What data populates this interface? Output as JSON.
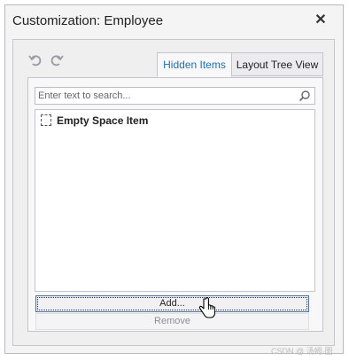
{
  "window": {
    "title": "Customization: Employee",
    "close_icon": "close-icon"
  },
  "toolbar": {
    "undo_icon": "undo-icon",
    "redo_icon": "redo-icon"
  },
  "tabs": [
    {
      "label": "Hidden Items",
      "active": true
    },
    {
      "label": "Layout Tree View",
      "active": false
    }
  ],
  "search": {
    "placeholder": "Enter text to search...",
    "value": "",
    "icon": "search-icon"
  },
  "hidden_items": [
    {
      "label": "Empty Space Item",
      "icon": "empty-space-item-icon"
    }
  ],
  "buttons": {
    "add": "Add...",
    "remove": "Remove"
  },
  "watermark": "CSDN @ 汤姆·图",
  "colors": {
    "accent": "#1e6fb4",
    "focus_border": "#4a6fa0",
    "disabled_text": "#8e8e96"
  }
}
